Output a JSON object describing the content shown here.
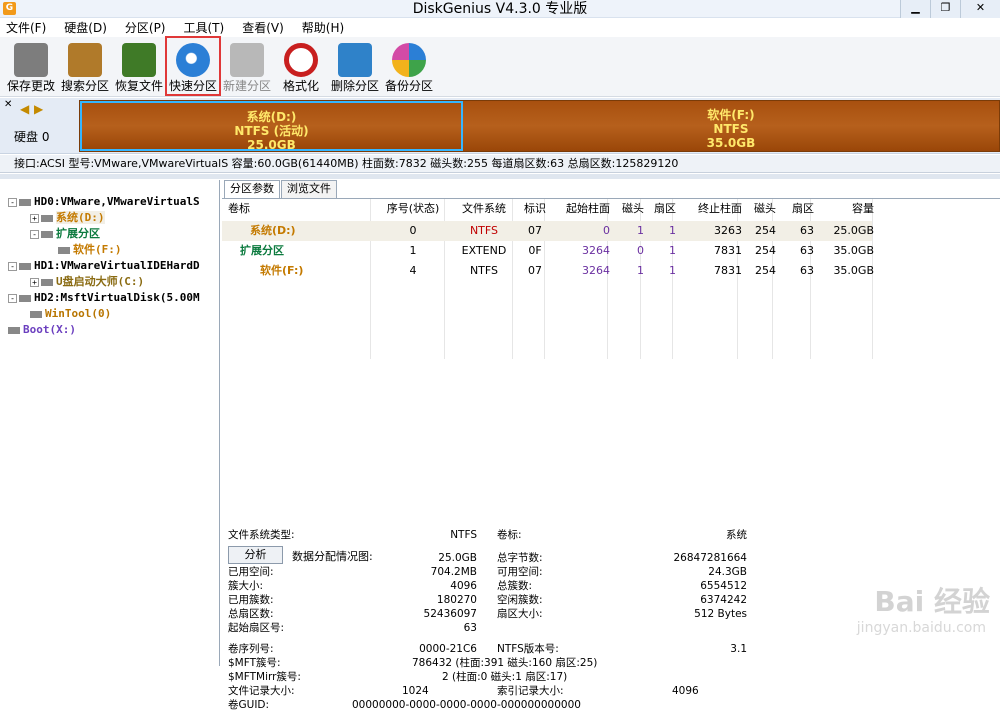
{
  "window": {
    "title": "DiskGenius V4.3.0 专业版"
  },
  "menu": [
    "文件(F)",
    "硬盘(D)",
    "分区(P)",
    "工具(T)",
    "查看(V)",
    "帮助(H)"
  ],
  "toolbar": [
    {
      "label": "保存更改",
      "icon": "save-icon",
      "color": "#7d7d7d",
      "enabled": true
    },
    {
      "label": "搜索分区",
      "icon": "search-icon",
      "color": "#b07a2a",
      "enabled": true
    },
    {
      "label": "恢复文件",
      "icon": "box-restore-icon",
      "color": "#3f7a27",
      "enabled": true
    },
    {
      "label": "快速分区",
      "icon": "disk-quick-icon",
      "color": "#2b7fd6",
      "enabled": true
    },
    {
      "label": "新建分区",
      "icon": "new-partition-icon",
      "color": "#b8b8b8",
      "enabled": false
    },
    {
      "label": "格式化",
      "icon": "format-icon",
      "color": "#c81f1f",
      "enabled": true
    },
    {
      "label": "删除分区",
      "icon": "delete-icon",
      "color": "#2f82c9",
      "enabled": true
    },
    {
      "label": "备份分区",
      "icon": "backup-pie-icon",
      "color": "#d34ba6",
      "enabled": true
    }
  ],
  "diskbar": {
    "disk_label": "硬盘 0",
    "partitions": [
      {
        "name": "系统(D:)",
        "fs": "NTFS (活动)",
        "size": "25.0GB",
        "share": 0.4167,
        "selected": true
      },
      {
        "name": "软件(F:)",
        "fs": "NTFS",
        "size": "35.0GB",
        "share": 0.5833,
        "selected": false
      }
    ]
  },
  "disk_info": "接口:ACSI  型号:VMware,VMwareVirtualS  容量:60.0GB(61440MB)  柱面数:7832  磁头数:255  每道扇区数:63  总扇区数:125829120",
  "tree": [
    {
      "label": "HD0:VMware,VMwareVirtualS",
      "level": 0,
      "expander": "-",
      "color": "#000"
    },
    {
      "label": "系统(D:)",
      "level": 1,
      "expander": "+",
      "color": "#c47a00",
      "highlight": true
    },
    {
      "label": "扩展分区",
      "level": 1,
      "expander": "-",
      "color": "#0b7a3e"
    },
    {
      "label": "软件(F:)",
      "level": 2,
      "expander": "",
      "color": "#c47a00"
    },
    {
      "label": "HD1:VMwareVirtualIDEHardD",
      "level": 0,
      "expander": "-",
      "color": "#000"
    },
    {
      "label": "U盘启动大师(C:)",
      "level": 1,
      "expander": "+",
      "color": "#8a6b12"
    },
    {
      "label": "HD2:MsftVirtualDisk(5.00M",
      "level": 0,
      "expander": "-",
      "color": "#000"
    },
    {
      "label": "WinTool(0)",
      "level": 1,
      "expander": "",
      "color": "#b87500"
    },
    {
      "label": "Boot(X:)",
      "level": 0,
      "expander": "",
      "color": "#6b3fbf"
    }
  ],
  "tabs": [
    "分区参数",
    "浏览文件"
  ],
  "table": {
    "headers": [
      "卷标",
      "序号(状态)",
      "文件系统",
      "标识",
      "起始柱面",
      "磁头",
      "扇区",
      "终止柱面",
      "磁头",
      "扇区",
      "容量"
    ],
    "rows": [
      {
        "label": "系统(D:)",
        "seq": "0",
        "fs": "NTFS",
        "id": "07",
        "start_cyl": "0",
        "head1": "1",
        "sec1": "1",
        "end_cyl": "3263",
        "head2": "254",
        "sec2": "63",
        "cap": "25.0GB",
        "color": "#c47a00",
        "fs_color": "#c00000",
        "indent": 1,
        "selected": true
      },
      {
        "label": "扩展分区",
        "seq": "1",
        "fs": "EXTEND",
        "id": "0F",
        "start_cyl": "3264",
        "head1": "0",
        "sec1": "1",
        "end_cyl": "7831",
        "head2": "254",
        "sec2": "63",
        "cap": "35.0GB",
        "color": "#0b7a3e",
        "fs_color": "#000",
        "indent": 0,
        "selected": false
      },
      {
        "label": "软件(F:)",
        "seq": "4",
        "fs": "NTFS",
        "id": "07",
        "start_cyl": "3264",
        "head1": "1",
        "sec1": "1",
        "end_cyl": "7831",
        "head2": "254",
        "sec2": "63",
        "cap": "35.0GB",
        "color": "#c47a00",
        "fs_color": "#000",
        "indent": 2,
        "selected": false
      }
    ]
  },
  "details": {
    "fs_type_label": "文件系统类型:",
    "fs_type": "NTFS",
    "vol_label_label": "卷标:",
    "vol_label": "系统",
    "left": [
      [
        "总容量:",
        "25.0GB"
      ],
      [
        "已用空间:",
        "704.2MB"
      ],
      [
        "簇大小:",
        "4096"
      ],
      [
        "已用簇数:",
        "180270"
      ],
      [
        "总扇区数:",
        "52436097"
      ],
      [
        "起始扇区号:",
        "63"
      ]
    ],
    "right": [
      [
        "总字节数:",
        "26847281664"
      ],
      [
        "可用空间:",
        "24.3GB"
      ],
      [
        "总簇数:",
        "6554512"
      ],
      [
        "空闲簇数:",
        "6374242"
      ],
      [
        "扇区大小:",
        "512 Bytes"
      ]
    ],
    "serial_label": "卷序列号:",
    "serial": "0000-21C6",
    "ntfs_ver_label": "NTFS版本号:",
    "ntfs_ver": "3.1",
    "mft_label": "$MFT簇号:",
    "mft": "786432 (柱面:391 磁头:160 扇区:25)",
    "mftmirr_label": "$MFTMirr簇号:",
    "mftmirr": "2 (柱面:0 磁头:1 扇区:17)",
    "frs_label": "文件记录大小:",
    "frs": "1024",
    "idx_label": "索引记录大小:",
    "idx": "4096",
    "guid_label": "卷GUID:",
    "guid": "00000000-0000-0000-0000-000000000000"
  },
  "analyze": {
    "button": "分析",
    "label": "数据分配情况图:"
  },
  "watermark": {
    "brand": "Bai 经验",
    "url": "jingyan.baidu.com"
  }
}
